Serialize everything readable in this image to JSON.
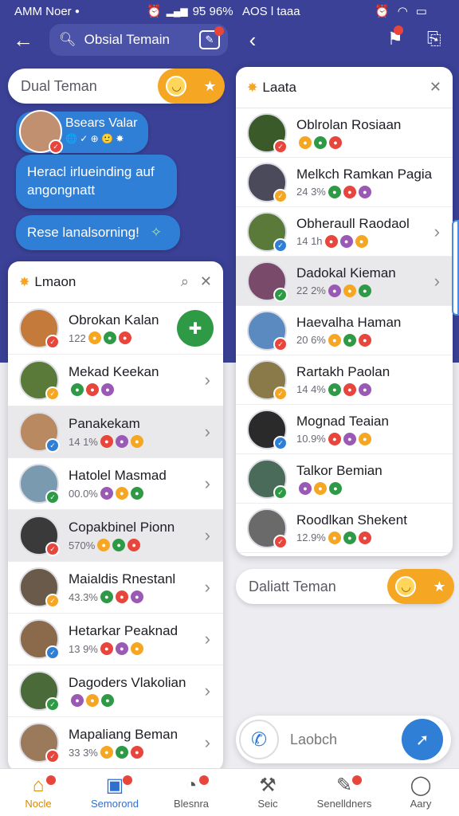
{
  "left": {
    "status_time": "AMM Noer",
    "status_right": "9̃5 96%",
    "search_label": "Obsial Temain",
    "input_placeholder": "Dual Teman",
    "chat": {
      "sender": "Bsears Valar",
      "message": "Heracl irlueinding auf angongnatt",
      "reply": "Rese lanalsorning!"
    },
    "panel": {
      "title": "Lmaon",
      "rows": [
        {
          "name": "Obrokan Kalan",
          "sub": "122",
          "color": "#c47a3b"
        },
        {
          "name": "Mekad Keekan",
          "sub": "",
          "color": "#5a7a3a"
        },
        {
          "name": "Panakekam",
          "sub": "14 1%",
          "color": "#b98a62"
        },
        {
          "name": "Hatolel Masmad",
          "sub": "00.0%",
          "color": "#7a9ab0"
        },
        {
          "name": "Copakbinel Pionn",
          "sub": "570%",
          "color": "#3a3a3a"
        },
        {
          "name": "Maialdis Rnestanl",
          "sub": "43.3%",
          "color": "#6a5a4a"
        },
        {
          "name": "Hetarkar Peaknad",
          "sub": "13 9%",
          "color": "#8a6a4a"
        },
        {
          "name": "Dagoders Vlakolian",
          "sub": "",
          "color": "#4a6a3a"
        },
        {
          "name": "Mapaliang Beman",
          "sub": "33 3%",
          "color": "#9a7a5a"
        }
      ]
    }
  },
  "right": {
    "status_time": "AOS l taaa",
    "panel": {
      "title": "Laata",
      "rows": [
        {
          "name": "Oblrolan Rosiaan",
          "sub": "",
          "color": "#3a5a2a"
        },
        {
          "name": "Melkch Ramkan Pagia",
          "sub": "24 3%",
          "color": "#4a4a5a"
        },
        {
          "name": "Obheraull Raodaol",
          "sub": "14 1h",
          "color": "#5a7a3a"
        },
        {
          "name": "Dadokal Kieman",
          "sub": "22 2%",
          "color": "#7a4a6a"
        },
        {
          "name": "Haevalha Haman",
          "sub": "20 6%",
          "color": "#5a8ac0"
        },
        {
          "name": "Rartakh Paolan",
          "sub": "14 4%",
          "color": "#8a7a4a"
        },
        {
          "name": "Mognad Teaian",
          "sub": "10.9%",
          "color": "#2a2a2a"
        },
        {
          "name": "Talkor Bemian",
          "sub": "",
          "color": "#4a6a5a"
        },
        {
          "name": "Roodlkan Shekent",
          "sub": "12.9%",
          "color": "#6a6a6a"
        }
      ]
    },
    "input_placeholder": "Daliatt Teman",
    "bottom_search_placeholder": "Laobch"
  },
  "nav": [
    {
      "label": "Nocle",
      "icon": "home-icon"
    },
    {
      "label": "Semorond",
      "icon": "chat-icon"
    },
    {
      "label": "Blesnra",
      "icon": "profile-icon"
    },
    {
      "label": "Seic",
      "icon": "tools-icon"
    },
    {
      "label": "Senelldners",
      "icon": "edit-icon"
    },
    {
      "label": "Aary",
      "icon": "person-icon"
    }
  ],
  "colors": {
    "header": "#3a4196",
    "accent": "#2f7fd6",
    "emoji": "#f5a623"
  }
}
